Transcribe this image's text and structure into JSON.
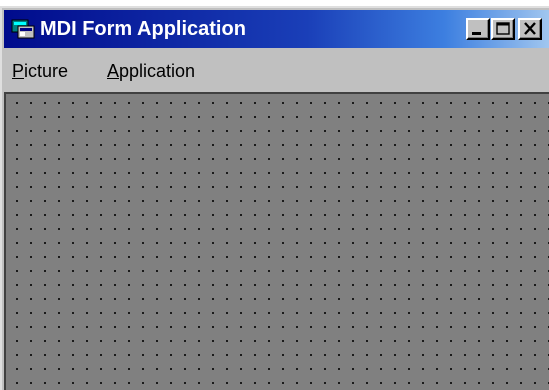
{
  "window": {
    "title": "MDI Form Application",
    "controls": {
      "minimize": "minimize-icon",
      "maximize": "maximize-icon",
      "close": "close-icon"
    }
  },
  "menu": {
    "items": [
      {
        "accel": "P",
        "rest": "icture"
      },
      {
        "accel": "A",
        "rest": "pplication"
      }
    ]
  },
  "colors": {
    "title_start": "#000b8c",
    "title_end": "#a6caf0",
    "face": "#c0c0c0",
    "workspace": "#808080"
  }
}
